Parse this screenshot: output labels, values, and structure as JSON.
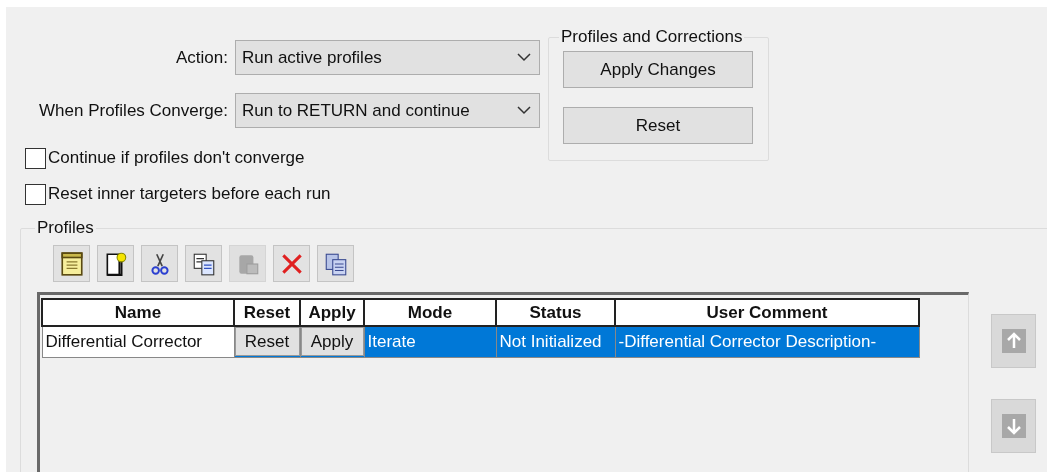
{
  "action": {
    "label": "Action:",
    "value": "Run active profiles"
  },
  "converge": {
    "label": "When Profiles Converge:",
    "value": "Run to RETURN and continue"
  },
  "options": [
    {
      "label": "Continue if profiles don't converge",
      "checked": false
    },
    {
      "label": "Reset inner targeters before each run",
      "checked": false
    }
  ],
  "corrections": {
    "title": "Profiles and Corrections",
    "buttons": [
      "Apply Changes",
      "Reset"
    ]
  },
  "profiles": {
    "title": "Profiles",
    "toolbar": [
      {
        "kind": "new",
        "disabled": false
      },
      {
        "kind": "insert",
        "disabled": false
      },
      {
        "kind": "cut",
        "disabled": false
      },
      {
        "kind": "copy",
        "disabled": false
      },
      {
        "kind": "paste",
        "disabled": true
      },
      {
        "kind": "delete",
        "disabled": false
      },
      {
        "kind": "duplicate",
        "disabled": false
      }
    ],
    "table": {
      "columns": [
        "Name",
        "Reset",
        "Apply",
        "Mode",
        "Status",
        "User Comment"
      ],
      "rows": [
        {
          "selected": true,
          "name": "Differential Corrector",
          "reset": "Reset",
          "apply": "Apply",
          "mode": "Iterate",
          "status": "Not Initialized",
          "comment": "-Differential Corrector Description-"
        }
      ]
    },
    "move_buttons": [
      {
        "kind": "up",
        "disabled": true
      },
      {
        "kind": "down",
        "disabled": true
      }
    ]
  }
}
